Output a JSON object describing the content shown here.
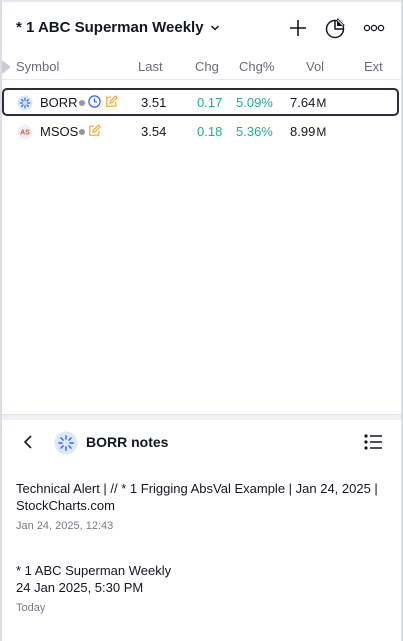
{
  "header": {
    "title": "* 1 ABC Superman Weekly",
    "icons": [
      "chevron-down-icon",
      "plus-icon",
      "chart-pie-icon",
      "more-icon"
    ]
  },
  "columns": {
    "symbol": "Symbol",
    "last": "Last",
    "chg": "Chg",
    "chgp": "Chg%",
    "vol": "Vol",
    "ext": "Ext"
  },
  "rows": [
    {
      "symbol": "BORR",
      "last": "3.51",
      "chg": "0.17",
      "chgp": "5.09%",
      "vol": "7.64",
      "vol_unit": "M",
      "ext": "",
      "selected": true
    },
    {
      "symbol": "MSOS",
      "last": "3.54",
      "chg": "0.18",
      "chgp": "5.36%",
      "vol": "8.99",
      "vol_unit": "M",
      "ext": "",
      "selected": false
    }
  ],
  "notes": {
    "title": "BORR notes",
    "items": [
      {
        "text": "Technical Alert | // * 1 Frigging AbsVal Example | Jan 24, 2025 | StockCharts.com",
        "time": "Jan 24, 2025, 12:43"
      },
      {
        "text": "* 1 ABC Superman Weekly\n24 Jan 2025, 5:30 PM",
        "time": "Today"
      }
    ]
  },
  "colors": {
    "up": "#22ab94",
    "accent": "#2962ff",
    "edit": "#f7a21b",
    "selected_border": "#2a2e39"
  }
}
